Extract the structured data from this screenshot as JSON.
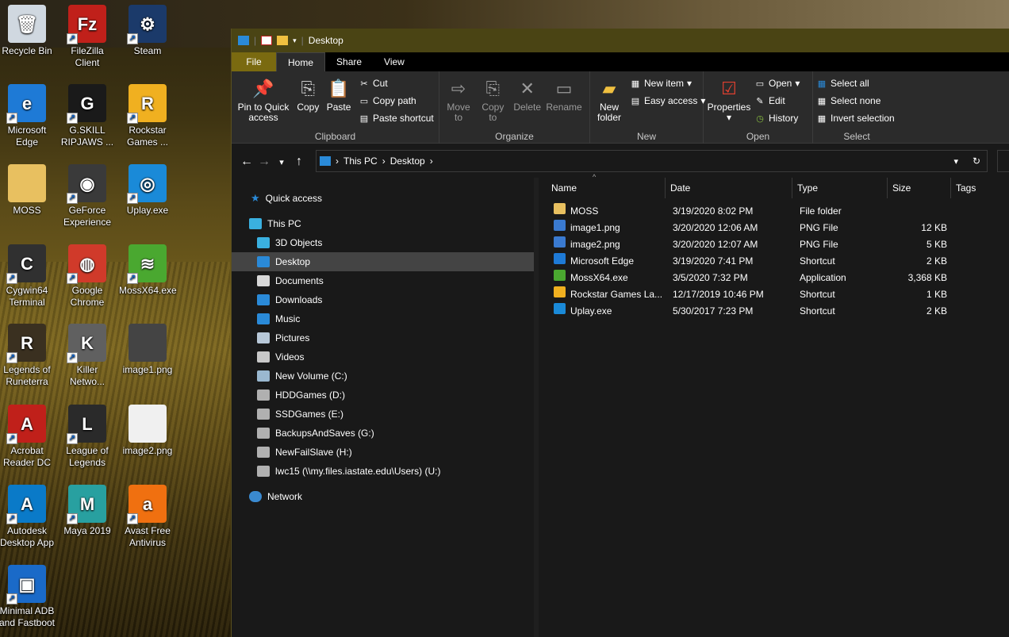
{
  "desktop": {
    "icons": [
      {
        "label": "Recycle Bin",
        "glyph": "🗑",
        "color": "#d0d8e0"
      },
      {
        "label": "FileZilla Client",
        "glyph": "Fz",
        "color": "#c0201a"
      },
      {
        "label": "Steam",
        "glyph": "⚙",
        "color": "#1b3a6a"
      },
      {
        "label": "Microsoft Edge",
        "glyph": "e",
        "color": "#1e7ad6"
      },
      {
        "label": "G.SKILL RIPJAWS ...",
        "glyph": "G",
        "color": "#1a1a1a"
      },
      {
        "label": "Rockstar Games ...",
        "glyph": "R",
        "color": "#f0b020"
      },
      {
        "label": "MOSS",
        "glyph": "",
        "color": "#e8c060"
      },
      {
        "label": "GeForce Experience",
        "glyph": "◉",
        "color": "#3a3a3a"
      },
      {
        "label": "Uplay.exe",
        "glyph": "◎",
        "color": "#1a8ad8"
      },
      {
        "label": "Cygwin64 Terminal",
        "glyph": "C",
        "color": "#303030"
      },
      {
        "label": "Google Chrome",
        "glyph": "◍",
        "color": "#d03a2a"
      },
      {
        "label": "MossX64.exe",
        "glyph": "≋",
        "color": "#4aa830"
      },
      {
        "label": "Legends of Runeterra",
        "glyph": "R",
        "color": "#3a3020"
      },
      {
        "label": "Killer Netwo...",
        "glyph": "K",
        "color": "#606060"
      },
      {
        "label": "image1.png",
        "glyph": "",
        "color": "#444444"
      },
      {
        "label": "Acrobat Reader DC",
        "glyph": "A",
        "color": "#c0201a"
      },
      {
        "label": "League of Legends",
        "glyph": "L",
        "color": "#2a2a2a"
      },
      {
        "label": "image2.png",
        "glyph": "",
        "color": "#f0f0f0"
      },
      {
        "label": "Autodesk Desktop App",
        "glyph": "A",
        "color": "#0a7ac8"
      },
      {
        "label": "Maya 2019",
        "glyph": "M",
        "color": "#28a0a0"
      },
      {
        "label": "Avast Free Antivirus",
        "glyph": "a",
        "color": "#f07010"
      },
      {
        "label": "Minimal ADB and Fastboot",
        "glyph": "▣",
        "color": "#1a6ac8"
      }
    ]
  },
  "window": {
    "title": "Desktop",
    "tabs": {
      "file": "File",
      "home": "Home",
      "share": "Share",
      "view": "View"
    },
    "ribbon": {
      "clipboard": {
        "label": "Clipboard",
        "pin": "Pin to Quick access",
        "copy": "Copy",
        "paste": "Paste",
        "cut": "Cut",
        "copy_path": "Copy path",
        "paste_shortcut": "Paste shortcut"
      },
      "organize": {
        "label": "Organize",
        "move_to": "Move to",
        "copy_to": "Copy to",
        "delete": "Delete",
        "rename": "Rename"
      },
      "new": {
        "label": "New",
        "new_folder": "New folder",
        "new_item": "New item",
        "easy_access": "Easy access"
      },
      "open": {
        "label": "Open",
        "properties": "Properties",
        "open": "Open",
        "edit": "Edit",
        "history": "History"
      },
      "select": {
        "label": "Select",
        "select_all": "Select all",
        "select_none": "Select none",
        "invert": "Invert selection"
      }
    },
    "address": {
      "this_pc": "This PC",
      "desktop": "Desktop"
    },
    "nav": {
      "quick_access": "Quick access",
      "this_pc": "This PC",
      "items": [
        {
          "label": "3D Objects",
          "color": "#3ab0e0"
        },
        {
          "label": "Desktop",
          "color": "#2a8ad8"
        },
        {
          "label": "Documents",
          "color": "#d8d8d8"
        },
        {
          "label": "Downloads",
          "color": "#2a8ad8"
        },
        {
          "label": "Music",
          "color": "#2a8ad8"
        },
        {
          "label": "Pictures",
          "color": "#b8c8d8"
        },
        {
          "label": "Videos",
          "color": "#c8c8c8"
        },
        {
          "label": "New Volume (C:)",
          "color": "#9ab8d0"
        },
        {
          "label": "HDDGames (D:)",
          "color": "#b0b0b0"
        },
        {
          "label": "SSDGames (E:)",
          "color": "#b0b0b0"
        },
        {
          "label": "BackupsAndSaves (G:)",
          "color": "#b0b0b0"
        },
        {
          "label": "NewFailSlave (H:)",
          "color": "#b0b0b0"
        },
        {
          "label": "lwc15 (\\\\my.files.iastate.edu\\Users) (U:)",
          "color": "#b0b0b0"
        }
      ],
      "network": "Network"
    },
    "columns": {
      "name": "Name",
      "date": "Date",
      "type": "Type",
      "size": "Size",
      "tags": "Tags"
    },
    "files": [
      {
        "name": "MOSS",
        "date": "3/19/2020 8:02 PM",
        "type": "File folder",
        "size": "",
        "color": "#e8c060"
      },
      {
        "name": "image1.png",
        "date": "3/20/2020 12:06 AM",
        "type": "PNG File",
        "size": "12 KB",
        "color": "#3a7ad0"
      },
      {
        "name": "image2.png",
        "date": "3/20/2020 12:07 AM",
        "type": "PNG File",
        "size": "5 KB",
        "color": "#3a7ad0"
      },
      {
        "name": "Microsoft Edge",
        "date": "3/19/2020 7:41 PM",
        "type": "Shortcut",
        "size": "2 KB",
        "color": "#1e7ad6"
      },
      {
        "name": "MossX64.exe",
        "date": "3/5/2020 7:32 PM",
        "type": "Application",
        "size": "3,368 KB",
        "color": "#4aa830"
      },
      {
        "name": "Rockstar Games La...",
        "date": "12/17/2019 10:46 PM",
        "type": "Shortcut",
        "size": "1 KB",
        "color": "#f0b020"
      },
      {
        "name": "Uplay.exe",
        "date": "5/30/2017 7:23 PM",
        "type": "Shortcut",
        "size": "2 KB",
        "color": "#1a8ad8"
      }
    ]
  }
}
